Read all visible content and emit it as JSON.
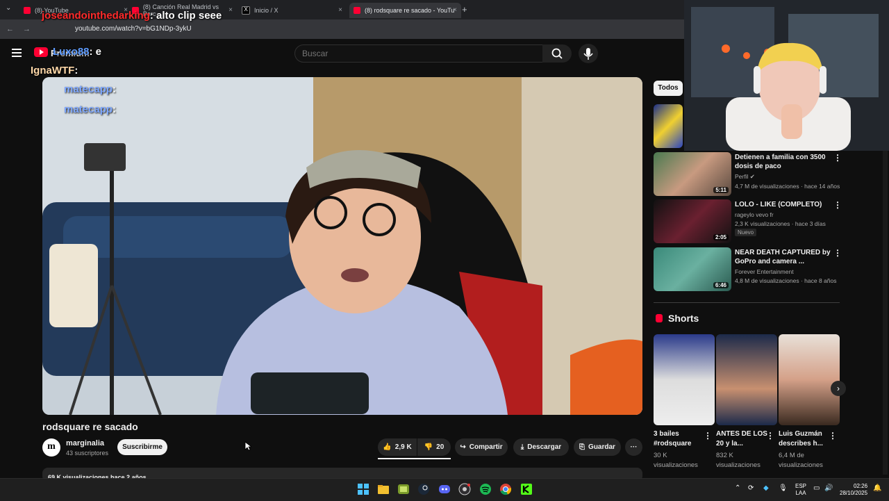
{
  "browser": {
    "tabs": [
      {
        "label": "(8) YouTube",
        "close": "×"
      },
      {
        "label": "(8) Canción Real Madrid vs Barc",
        "close": "×"
      },
      {
        "label": "Inicio / X",
        "close": "×"
      },
      {
        "label": "(8) rodsquare re sacado - YouTu",
        "close": "×"
      }
    ],
    "new_tab": "+",
    "tab_menu": "⌄",
    "url": "youtube.com/watch?v=bG1NDp-3ykU"
  },
  "youtube": {
    "logo_label": "Premium",
    "search_placeholder": "Buscar"
  },
  "chat_overlay": [
    {
      "user": "joseandointhedarking",
      "message": ": alto clip seee"
    },
    {
      "user": "Luxo88",
      "message": ": e"
    },
    {
      "user": "IgnaWTF",
      "message": ":"
    },
    {
      "user": "matecapp",
      "message": ":"
    },
    {
      "user": "matecapp",
      "message": ":"
    }
  ],
  "video": {
    "title": "rodsquare re sacado",
    "channel_initial": "m",
    "channel_name": "marginalia",
    "subscribers": "43 suscriptores",
    "subscribe_label": "Suscribirme",
    "likes": "2,9 K",
    "dislikes": "20",
    "share_label": "Compartir",
    "download_label": "Descargar",
    "save_label": "Guardar",
    "description_meta": "69 K visualizaciones  hace 2 años"
  },
  "sidebar": {
    "chip_label": "Todos",
    "recommendations": [
      {
        "title": "Detienen a familia con 3500 dosis de paco",
        "channel": "Perfil",
        "meta": "4,7 M de visualizaciones · hace 14 años",
        "duration": "5:11"
      },
      {
        "title": "LOLO - LIKE (COMPLETO)",
        "channel": "rageylo vevo fr",
        "meta": "2,3 K visualizaciones · hace 3 días",
        "duration": "2:05",
        "badge": "Nuevo"
      },
      {
        "title": "NEAR DEATH CAPTURED by GoPro and camera ...",
        "channel": "Forever Entertainment",
        "meta": "4,8 M de visualizaciones · hace 8 años",
        "duration": "6:46"
      }
    ],
    "shorts_heading": "Shorts",
    "shorts": [
      {
        "title": "3 bailes #rodsquare",
        "meta": "30 K visualizaciones"
      },
      {
        "title": "ANTES DE LOS 20 y la...",
        "meta": "832 K visualizaciones"
      },
      {
        "title": "Luis Guzmán describes h...",
        "meta": "6,4 M de visualizaciones"
      }
    ]
  },
  "taskbar": {
    "lang_top": "ESP",
    "lang_bottom": "LAA",
    "time": "02:26",
    "date": "28/10/2025"
  },
  "colors": {
    "youtube_red": "#ff0033",
    "background": "#0f0f0f",
    "chat_name_red": "#ff2a2a",
    "chat_name_blue": "#5f9cff"
  }
}
